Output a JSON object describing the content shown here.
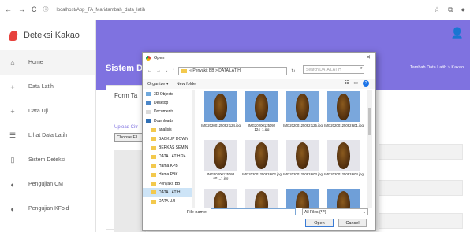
{
  "browser": {
    "url": "localhost/App_TA_Mari/tambah_data_latih"
  },
  "brand": {
    "name": "Deteksi Kakao"
  },
  "sidebar": {
    "items": [
      {
        "label": "Home",
        "icon": "home-icon",
        "glyph": "⌂"
      },
      {
        "label": "Data Latih",
        "icon": "plus-icon",
        "glyph": "+"
      },
      {
        "label": "Data Uji",
        "icon": "plus-icon",
        "glyph": "+"
      },
      {
        "label": "Lihat Data Latih",
        "icon": "list-icon",
        "glyph": "☰"
      },
      {
        "label": "Sistem Deteksi",
        "icon": "document-icon",
        "glyph": "▯"
      },
      {
        "label": "Pengujian CM",
        "icon": "circle-icon",
        "glyph": "◐"
      },
      {
        "label": "Pengujian KFold",
        "icon": "circle-icon",
        "glyph": "◐"
      }
    ]
  },
  "header": {
    "title": "Sistem D",
    "breadcrumb": "Tambah Data Latih > Kakao"
  },
  "form": {
    "title": "Form Ta",
    "upload_label": "Upload Citr",
    "choose_button": "Choose Fil"
  },
  "dialog": {
    "title": "Open",
    "address": "« Penyakit BB > DATA LATIH",
    "search_placeholder": "Search DATA LATIH",
    "organize": "Organize ▾",
    "new_folder": "New folder",
    "nav_items": [
      {
        "label": "3D Objects",
        "color": "#6fa8dc"
      },
      {
        "label": "Desktop",
        "color": "#4a86c8"
      },
      {
        "label": "Documents",
        "color": "#d9d9d9"
      },
      {
        "label": "Downloads",
        "color": "#2f6fb5"
      },
      {
        "label": "analisis",
        "color": "#f3c94d"
      },
      {
        "label": "BACKUP DOWN",
        "color": "#f3c94d"
      },
      {
        "label": "BERKAS SEMIN",
        "color": "#f3c94d"
      },
      {
        "label": "DATA LATIH 24",
        "color": "#f3c94d"
      },
      {
        "label": "Hama KPB",
        "color": "#f3c94d"
      },
      {
        "label": "Hama PBK",
        "color": "#f3c94d"
      },
      {
        "label": "Penyakit BB",
        "color": "#f3c94d"
      },
      {
        "label": "DATA LATIH",
        "color": "#f3c94d",
        "selected": true
      },
      {
        "label": "DATA UJI",
        "color": "#f3c94d"
      }
    ],
    "files": [
      {
        "name": "IMG20200125092 124.jpg",
        "bg": "#6f9fd8"
      },
      {
        "name": "IMG20200125092 124_1.jpg",
        "bg": "#6f9fd8"
      },
      {
        "name": "IMG20200125092 125.jpg",
        "bg": "#7aa7dc"
      },
      {
        "name": "IMG20200125092 601.jpg",
        "bg": "#7aa7dc"
      },
      {
        "name": "IMG20200125093 601_1.jpg",
        "bg": "#e4e4ea"
      },
      {
        "name": "IMG20200125093 602.jpg",
        "bg": "#e4e4ea"
      },
      {
        "name": "IMG20200125093 603.jpg",
        "bg": "#e4e4ea"
      },
      {
        "name": "IMG20200125093 604.jpg",
        "bg": "#e4e4ea"
      },
      {
        "name": "",
        "bg": "#e4e4ea"
      },
      {
        "name": "",
        "bg": "#e4e4ea"
      },
      {
        "name": "",
        "bg": "#6f9fd8"
      },
      {
        "name": "",
        "bg": "#6f9fd8"
      }
    ],
    "filename_label": "File name:",
    "filetype": "All Files (*.*)",
    "open_button": "Open",
    "cancel_button": "Cancel"
  }
}
